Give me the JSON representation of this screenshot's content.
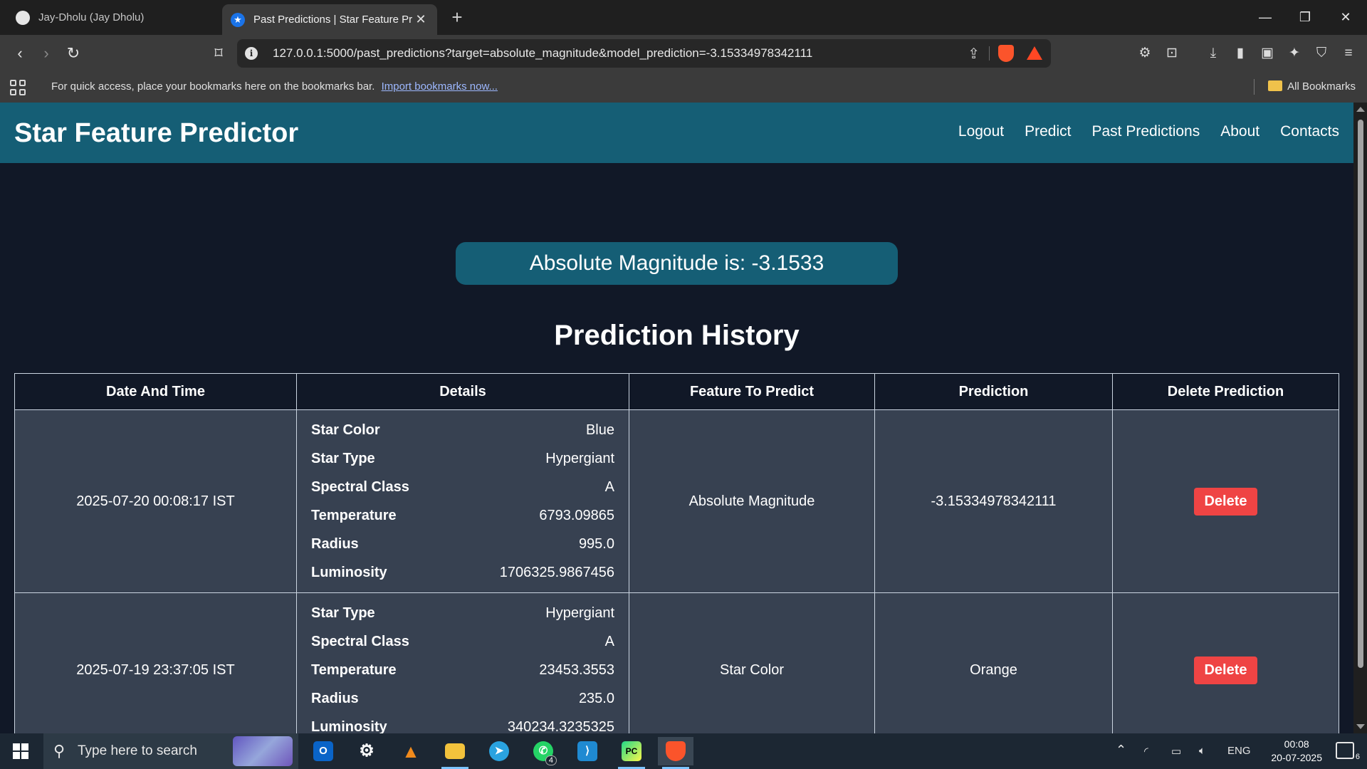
{
  "browser": {
    "tabs": [
      {
        "title": "Jay-Dholu (Jay Dholu)",
        "active": false
      },
      {
        "title": "Past Predictions | Star Feature Pr",
        "active": true
      }
    ],
    "url": "127.0.0.1:5000/past_predictions?target=absolute_magnitude&model_prediction=-3.15334978342111",
    "bookmarks_message": "For quick access, place your bookmarks here on the bookmarks bar.",
    "import_link": "Import bookmarks now...",
    "all_bookmarks": "All Bookmarks"
  },
  "site": {
    "brand": "Star Feature Predictor",
    "nav": [
      "Logout",
      "Predict",
      "Past Predictions",
      "About",
      "Contacts"
    ]
  },
  "result": {
    "text": "Absolute Magnitude is: -3.1533"
  },
  "history": {
    "title": "Prediction History",
    "columns": [
      "Date And Time",
      "Details",
      "Feature To Predict",
      "Prediction",
      "Delete Prediction"
    ],
    "rows": [
      {
        "datetime": "2025-07-20 00:08:17 IST",
        "details": [
          {
            "key": "Star Color",
            "value": "Blue"
          },
          {
            "key": "Star Type",
            "value": "Hypergiant"
          },
          {
            "key": "Spectral Class",
            "value": "A"
          },
          {
            "key": "Temperature",
            "value": "6793.09865"
          },
          {
            "key": "Radius",
            "value": "995.0"
          },
          {
            "key": "Luminosity",
            "value": "1706325.9867456"
          }
        ],
        "feature": "Absolute Magnitude",
        "prediction": "-3.15334978342111",
        "delete_label": "Delete"
      },
      {
        "datetime": "2025-07-19 23:37:05 IST",
        "details": [
          {
            "key": "Star Type",
            "value": "Hypergiant"
          },
          {
            "key": "Spectral Class",
            "value": "A"
          },
          {
            "key": "Temperature",
            "value": "23453.3553"
          },
          {
            "key": "Radius",
            "value": "235.0"
          },
          {
            "key": "Luminosity",
            "value": "340234.3235325"
          }
        ],
        "feature": "Star Color",
        "prediction": "Orange",
        "delete_label": "Delete"
      }
    ]
  },
  "taskbar": {
    "search_placeholder": "Type here to search",
    "whatsapp_badge": "4",
    "language": "ENG",
    "time": "00:08",
    "date": "20-07-2025",
    "notification_count": "6"
  },
  "colors": {
    "navbar": "#155e75",
    "page_bg": "#111827",
    "row_bg": "#374151",
    "delete_button": "#ef4444"
  }
}
